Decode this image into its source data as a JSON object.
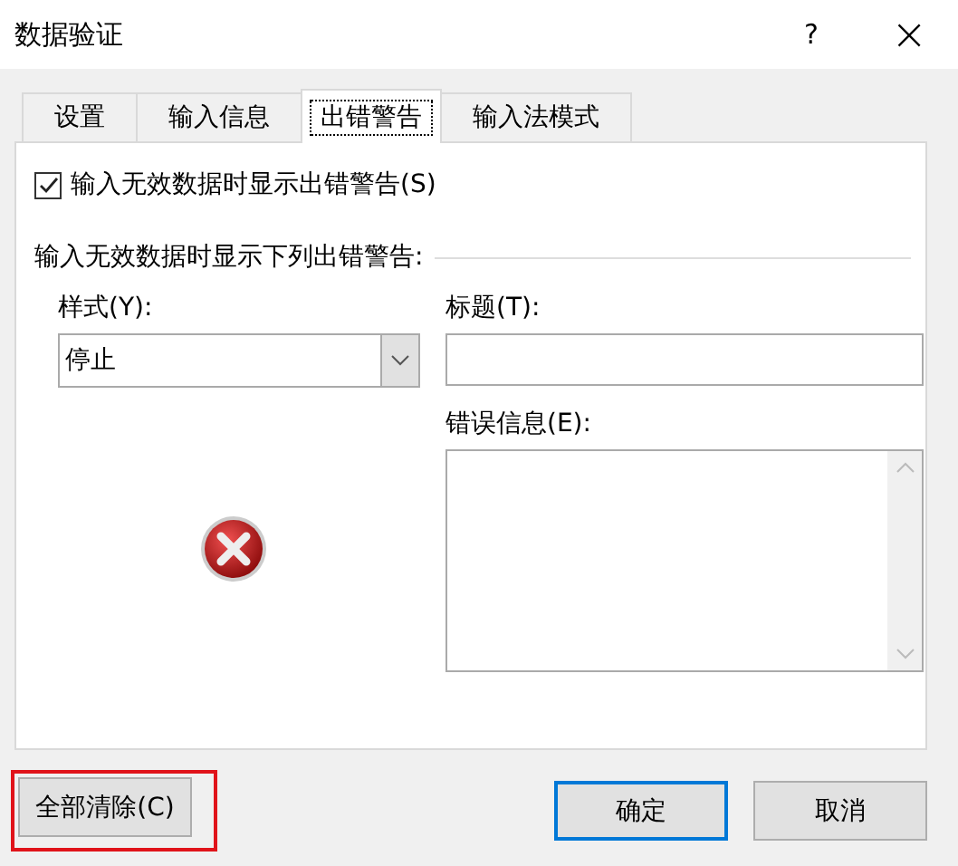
{
  "window": {
    "title": "数据验证",
    "help": "?",
    "close": "×"
  },
  "tabs": [
    {
      "label": "设置",
      "selected": false
    },
    {
      "label": "输入信息",
      "selected": false
    },
    {
      "label": "出错警告",
      "selected": true
    },
    {
      "label": "输入法模式",
      "selected": false
    }
  ],
  "show_alert": {
    "label": "输入无效数据时显示出错警告(S)",
    "checked": true
  },
  "group_label": "输入无效数据时显示下列出错警告:",
  "style": {
    "label": "样式(Y):",
    "value": "停止"
  },
  "title_field": {
    "label": "标题(T):"
  },
  "message_field": {
    "label": "错误信息(E):"
  },
  "clear_button_highlight": true,
  "buttons": [
    {
      "label": "全部清除(C)",
      "kind": "clear"
    },
    {
      "label": "确定",
      "kind": "ok"
    },
    {
      "label": "取消",
      "kind": "cancel"
    }
  ]
}
